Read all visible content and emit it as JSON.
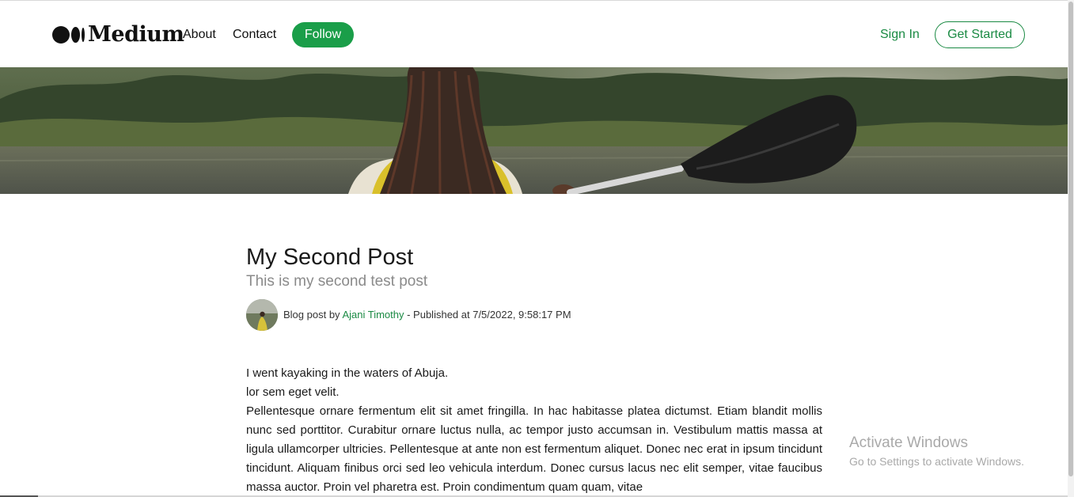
{
  "header": {
    "brand": "Medium",
    "nav": {
      "about": "About",
      "contact": "Contact"
    },
    "follow_label": "Follow",
    "signin_label": "Sign In",
    "get_started_label": "Get Started"
  },
  "post": {
    "title": "My Second Post",
    "subtitle": "This is my second test post",
    "meta": {
      "by_prefix": "Blog post by",
      "author": "Ajani Timothy",
      "published": " - Published at 7/5/2022, 9:58:17 PM"
    },
    "body": [
      "I went kayaking in the waters of Abuja.",
      "lor sem eget velit.",
      "Pellentesque ornare fermentum elit sit amet fringilla. In hac habitasse platea dictumst. Etiam blandit mollis nunc sed porttitor. Curabitur ornare luctus nulla, ac tempor justo accumsan in. Vestibulum mattis massa at ligula ullamcorper ultricies. Pellentesque at ante non est fermentum aliquet. Donec nec erat in ipsum tincidunt tincidunt. Aliquam finibus orci sed leo vehicula interdum. Donec cursus lacus nec elit semper, vitae faucibus massa auctor. Proin vel pharetra est. Proin condimentum quam quam, vitae"
    ]
  },
  "watermark": {
    "title": "Activate Windows",
    "subtitle": "Go to Settings to activate Windows."
  },
  "colors": {
    "accent": "#1a9e49",
    "accent_text": "#1a8a43",
    "subtitle": "#8a8a8a"
  },
  "icons": {
    "brand": "medium-logo-icon"
  }
}
